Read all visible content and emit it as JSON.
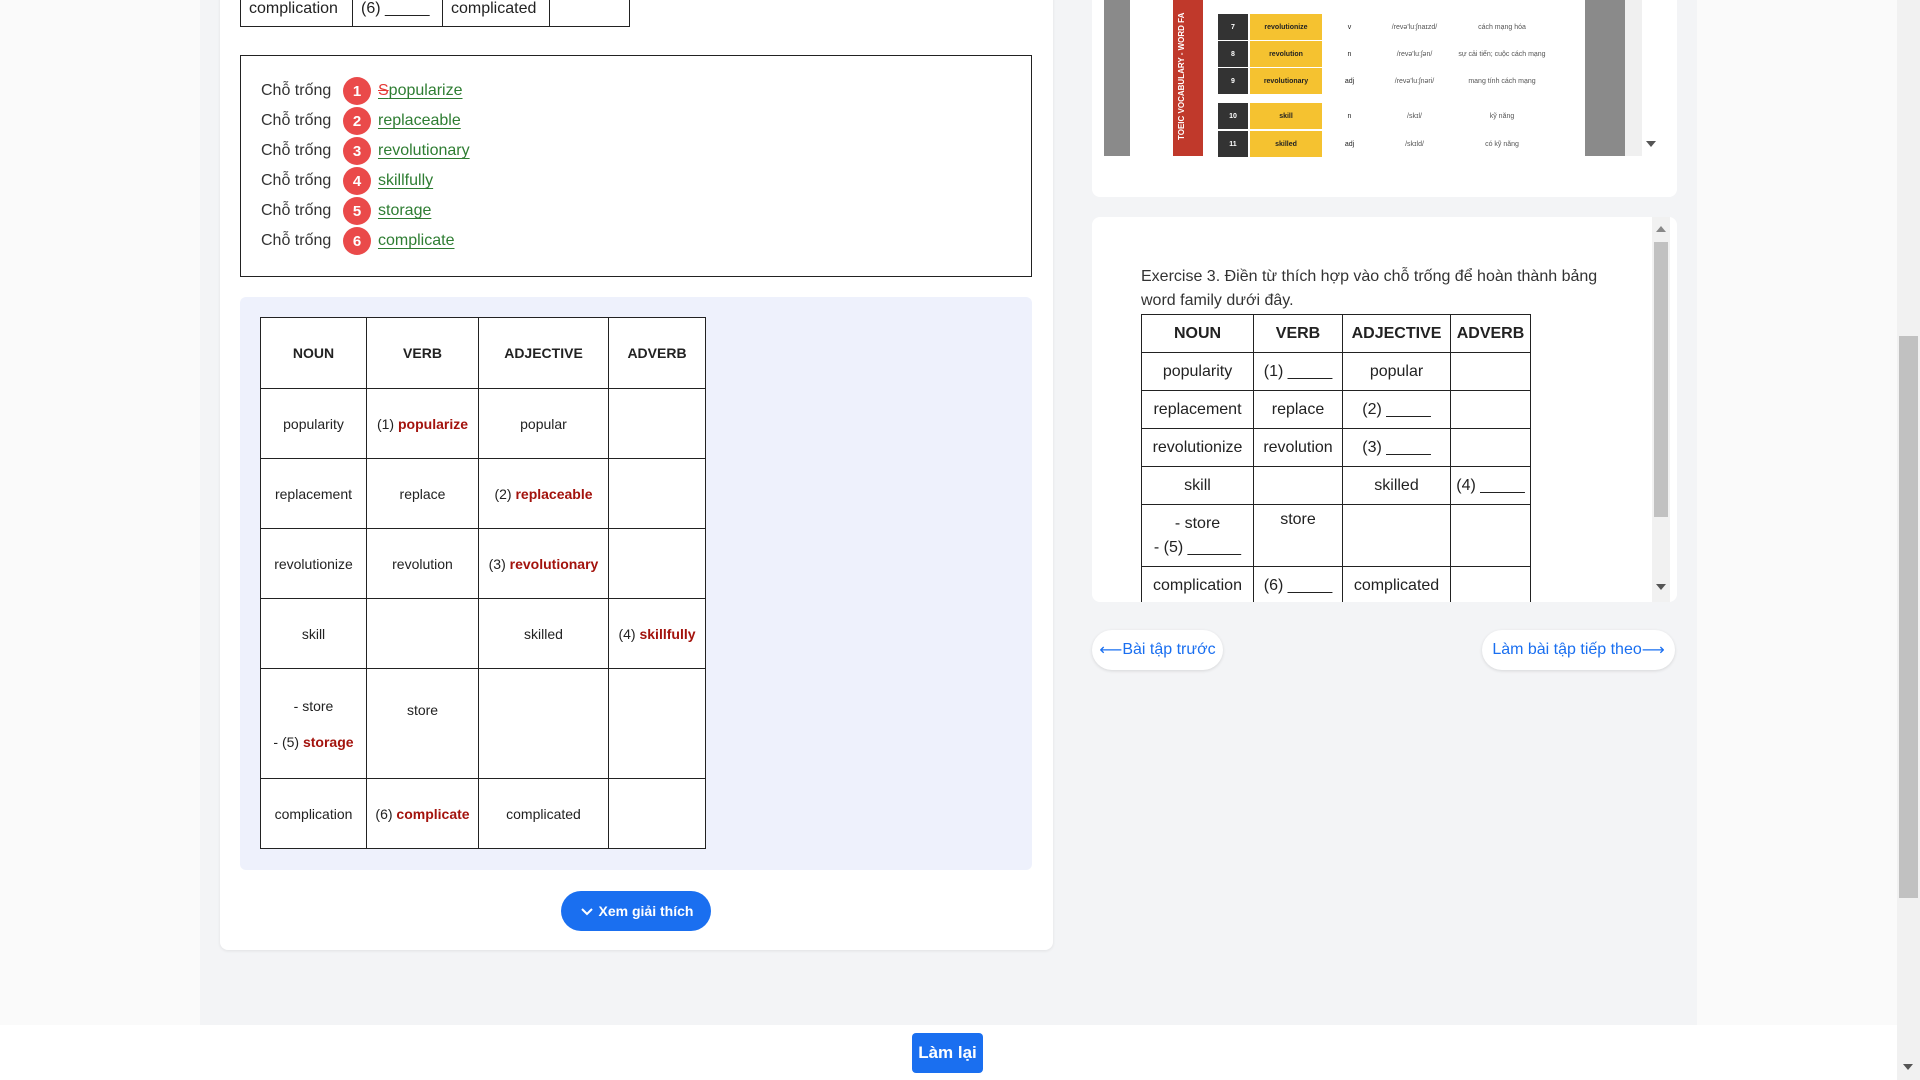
{
  "top_table": {
    "cells": [
      "complication",
      "(6) _____",
      "complicated",
      ""
    ]
  },
  "answers": {
    "label": "Chỗ trống",
    "items": [
      {
        "num": "1",
        "struck": "S",
        "text": "popularize"
      },
      {
        "num": "2",
        "struck": "",
        "text": "replaceable"
      },
      {
        "num": "3",
        "struck": "",
        "text": "revolutionary"
      },
      {
        "num": "4",
        "struck": "",
        "text": "skillfully"
      },
      {
        "num": "5",
        "struck": "",
        "text": "storage"
      },
      {
        "num": "6",
        "struck": "",
        "text": "complicate"
      }
    ]
  },
  "solution_table": {
    "headers": [
      "NOUN",
      "VERB",
      "ADJECTIVE",
      "ADVERB"
    ],
    "rows": [
      {
        "noun": "popularity",
        "verb_prefix": "(1) ",
        "verb_ans": "popularize",
        "adj": "popular",
        "adv": ""
      },
      {
        "noun": "replacement",
        "verb": "replace",
        "adj_prefix": "(2) ",
        "adj_ans": "replaceable",
        "adv": ""
      },
      {
        "noun": "revolutionize",
        "verb": "revolution",
        "adj_prefix": "(3) ",
        "adj_ans": "revolutionary",
        "adv": ""
      },
      {
        "noun": "skill",
        "verb": "",
        "adj": "skilled",
        "adv_prefix": "(4)  ",
        "adv_ans": "skillfully"
      },
      {
        "noun_line1": "- store",
        "noun_prefix": "- (5) ",
        "noun_ans": "storage",
        "verb": "store",
        "adj": "",
        "adv": ""
      },
      {
        "noun": "complication",
        "verb_prefix": "(6) ",
        "verb_ans": "complicate",
        "adj": "complicated",
        "adv": ""
      }
    ]
  },
  "explain_button": {
    "label": "Xem giải thích"
  },
  "vocab_image": {
    "side_text": "TOEIC VOCABULARY - WORD FA",
    "rows": [
      {
        "num": "7",
        "word": "revolutionize",
        "pos": "v",
        "ipa": "/revə'luːʃnaɪzd/",
        "meaning": "cách mạng hóa"
      },
      {
        "num": "8",
        "word": "revolution",
        "pos": "n",
        "ipa": "/revə'luːʃən/",
        "meaning": "sự cải tiến; cuộc cách mạng"
      },
      {
        "num": "9",
        "word": "revolutionary",
        "pos": "adj",
        "ipa": "/revə'luːʃnəri/",
        "meaning": "mang tính cách mạng"
      },
      {
        "num": "10",
        "word": "skill",
        "pos": "n",
        "ipa": "/skɪl/",
        "meaning": "kỹ năng"
      },
      {
        "num": "11",
        "word": "skilled",
        "pos": "adj",
        "ipa": "/skɪld/",
        "meaning": "có kỹ năng"
      }
    ]
  },
  "exercise": {
    "title": "Exercise 3. Điền từ thích hợp vào chỗ trống để hoàn thành bảng word family dưới đây.",
    "headers": [
      "NOUN",
      "VERB",
      "ADJECTIVE",
      "ADVERB"
    ],
    "rows": [
      [
        "popularity",
        "(1)  _____",
        "popular",
        ""
      ],
      [
        "replacement",
        "replace",
        "(2)  _____",
        ""
      ],
      [
        "revolutionize",
        "revolution",
        "(3)  _____",
        ""
      ],
      [
        "skill",
        "",
        "skilled",
        "(4)  _____"
      ],
      [
        "- store\n- (5) ______",
        "store",
        "",
        ""
      ],
      [
        "complication",
        "(6)  _____",
        "complicated",
        ""
      ]
    ]
  },
  "nav": {
    "prev_label": "Bài tập trước",
    "next_label": "Làm bài tập tiếp theo"
  },
  "redo_button": {
    "label": "Làm lại"
  },
  "colors": {
    "accent": "#1a6ff0",
    "badge": "#ea4a4a",
    "answer_green": "#2e7d32",
    "answer_red": "#a3130d"
  }
}
